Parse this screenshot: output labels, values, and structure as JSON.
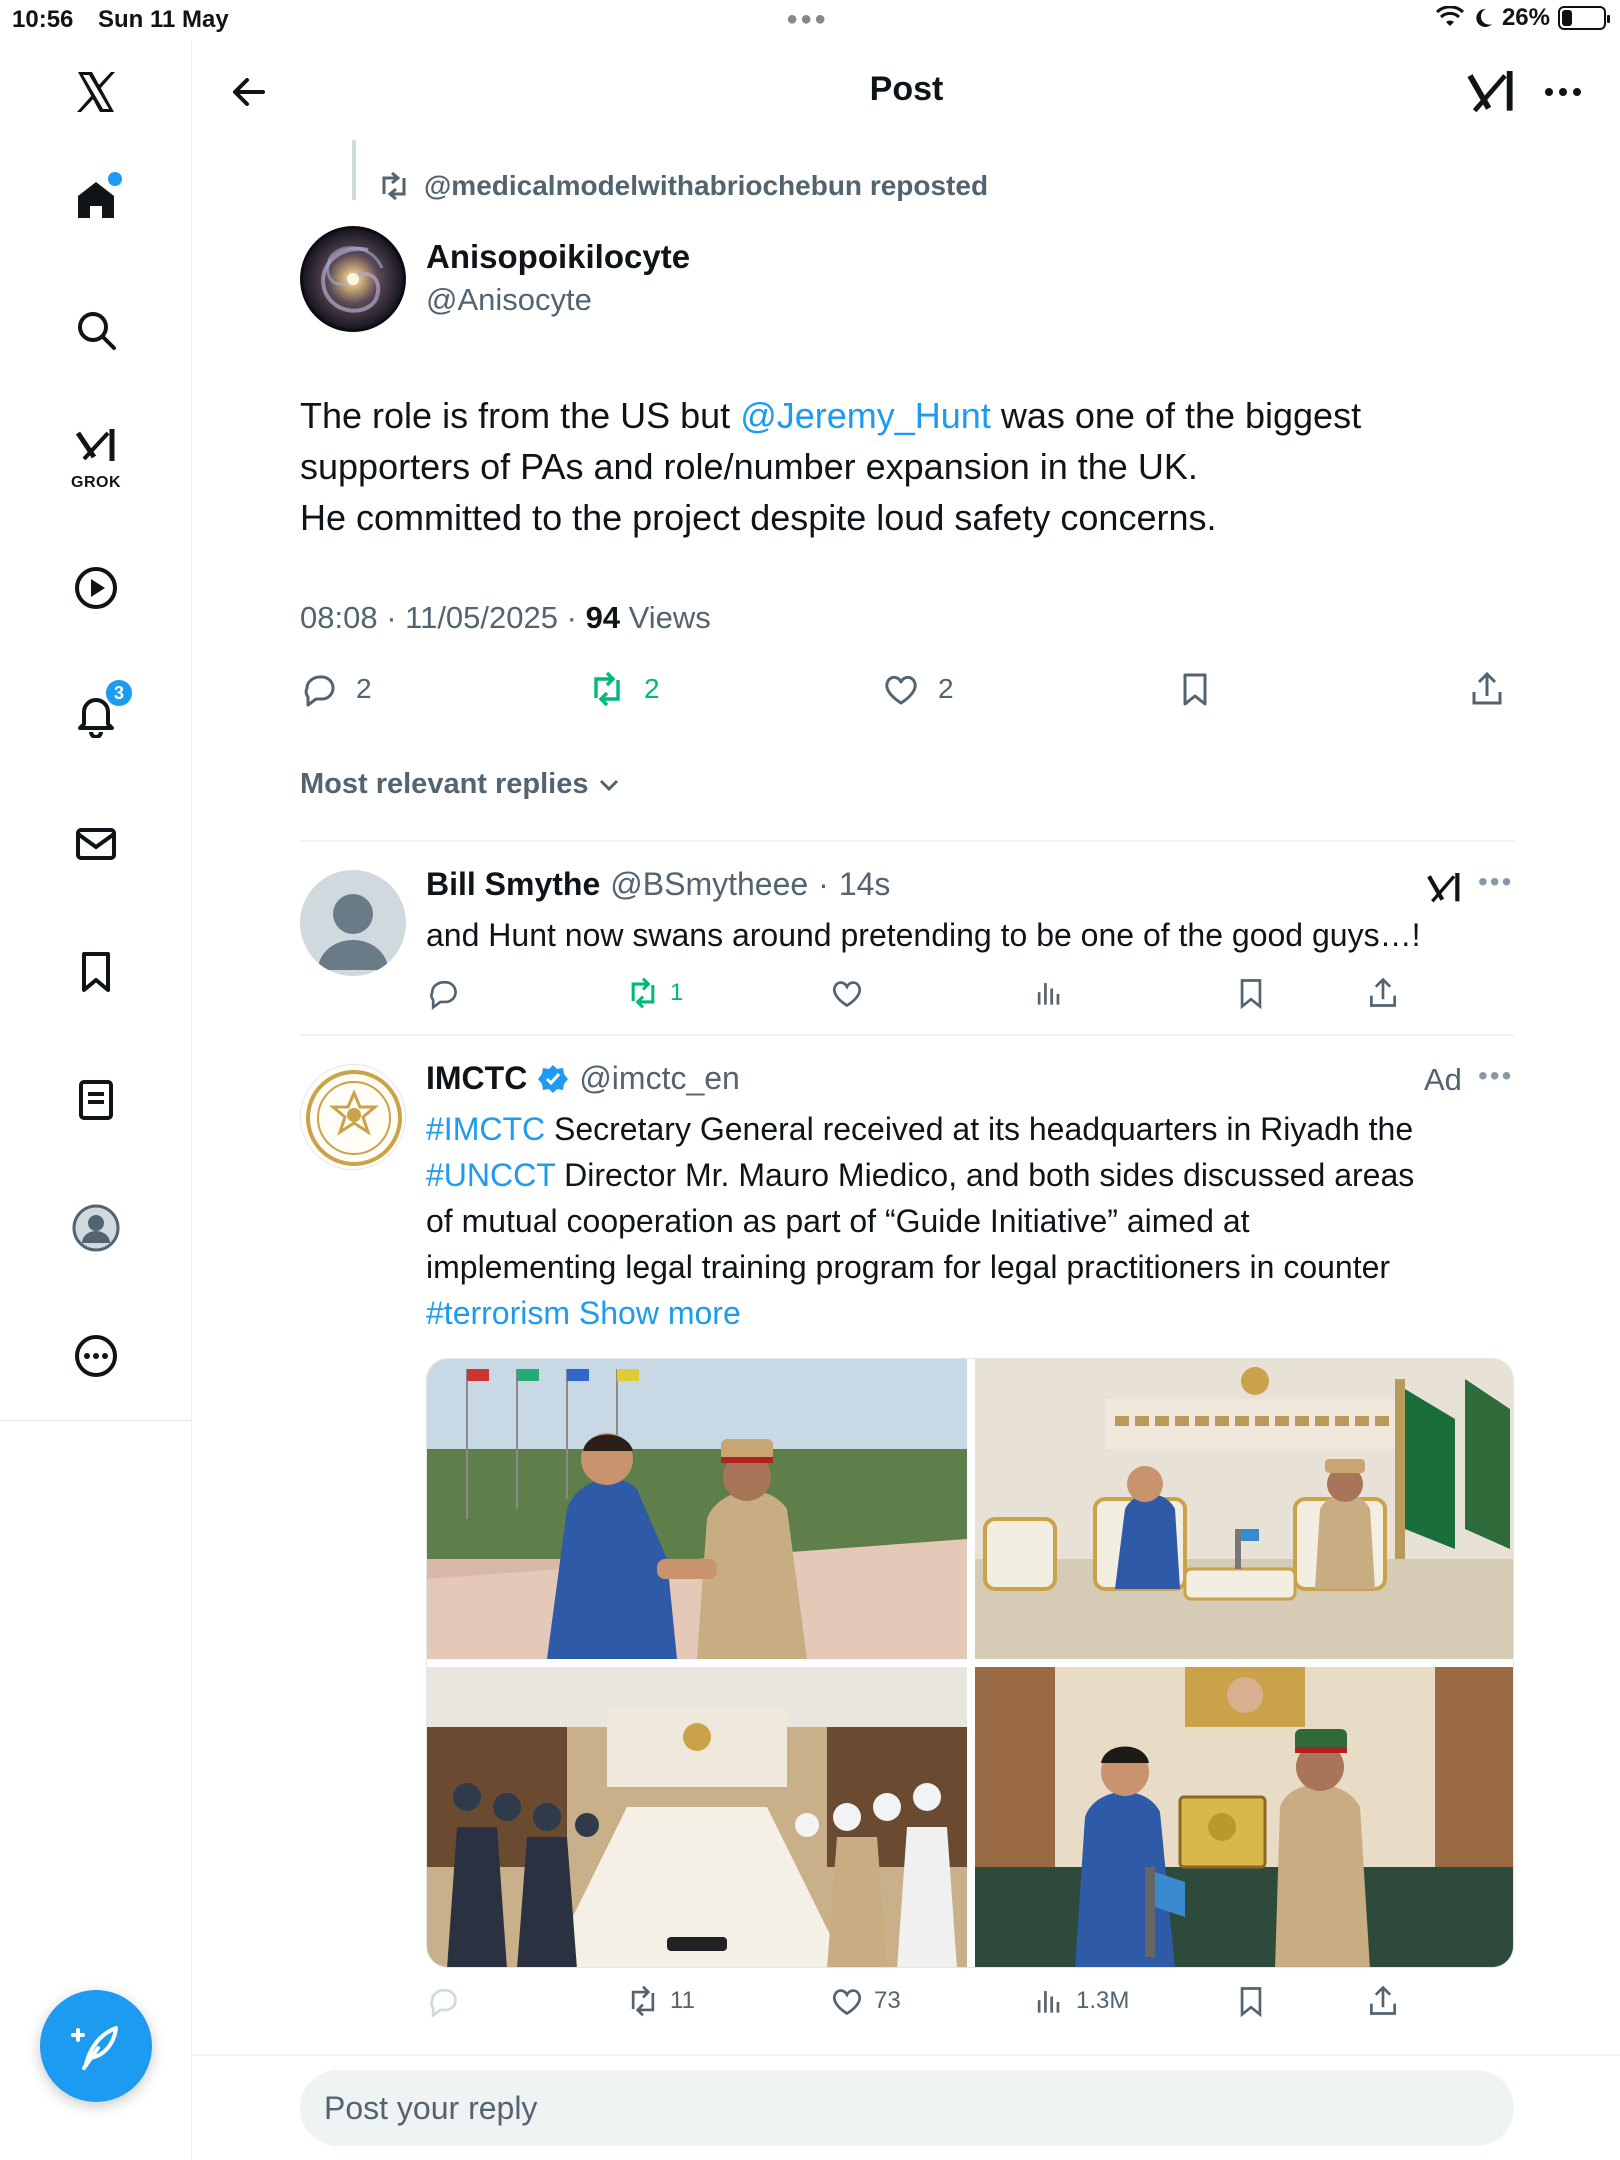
{
  "status_bar": {
    "time": "10:56",
    "date": "Sun 11 May",
    "battery": "26%",
    "battery_level": 0.26
  },
  "sidebar": {
    "items": [
      {
        "name": "x-logo-icon"
      },
      {
        "name": "home-icon"
      },
      {
        "name": "search-icon"
      },
      {
        "name": "grok-icon",
        "label": "GROK"
      },
      {
        "name": "video-icon"
      },
      {
        "name": "notifications-icon",
        "badge": "3"
      },
      {
        "name": "messages-icon"
      },
      {
        "name": "bookmarks-icon"
      },
      {
        "name": "lists-icon"
      },
      {
        "name": "profile-icon"
      },
      {
        "name": "more-icon"
      }
    ],
    "compose_icon": "compose-icon"
  },
  "header": {
    "title": "Post"
  },
  "post": {
    "repost_label": "@medicalmodelwithabriochebun reposted",
    "author_name": "Anisopoikilocyte",
    "author_handle": "@Anisocyte",
    "text_before": "The role is from the US but ",
    "mention": "@Jeremy_Hunt",
    "text_after_line1": " was one of the biggest",
    "text_line2": "supporters of PAs and role/number expansion in the UK.",
    "text_line3": "He committed to the project despite loud safety concerns.",
    "time": "08:08",
    "date": "11/05/2025",
    "views_count": "94",
    "views_label": "Views",
    "replies": "2",
    "reposts": "2",
    "likes": "2"
  },
  "sort_label": "Most relevant replies",
  "replies": [
    {
      "name": "Bill Smythe",
      "handle": "@BSmytheee",
      "time": "14s",
      "text": "and Hunt now swans around pretending to be one of the good guys…!",
      "reposts": "1"
    }
  ],
  "ad": {
    "name": "IMCTC",
    "handle": "@imctc_en",
    "ad_label": "Ad",
    "hashtag1": "#IMCTC",
    "text1": " Secretary General received at its headquarters in Riyadh the",
    "hashtag2": "#UNCCT",
    "text2": " Director Mr. Mauro Miedico, and both sides discussed areas",
    "text3": "of mutual cooperation as part of “Guide Initiative” aimed at",
    "text4": "implementing legal training program for legal practitioners in counter",
    "hashtag3": "#terrorism",
    "show_more": "Show more",
    "reposts": "11",
    "likes": "73",
    "views": "1.3M"
  },
  "composer": {
    "placeholder": "Post your reply"
  },
  "colors": {
    "accent": "#1d9bf0",
    "repost_green": "#00ba7c",
    "muted": "#536471"
  }
}
